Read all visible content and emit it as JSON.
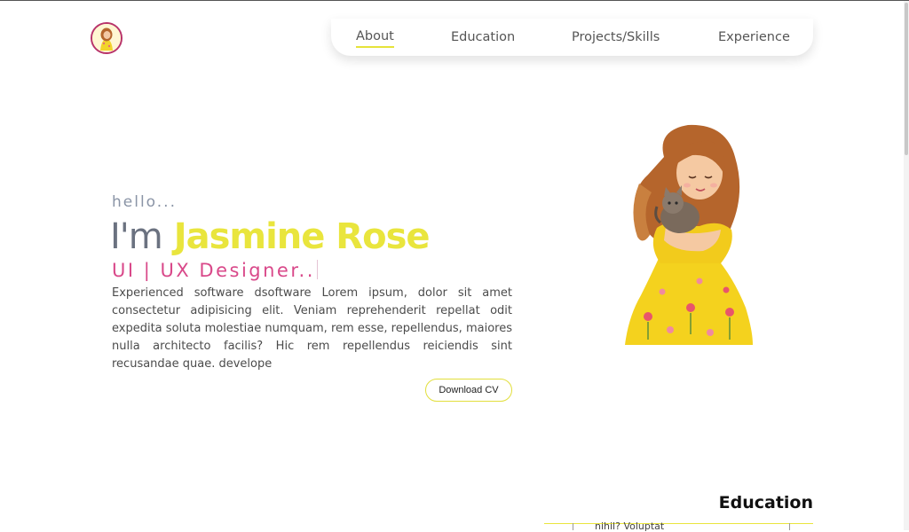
{
  "nav": {
    "items": [
      {
        "label": "About",
        "active": true
      },
      {
        "label": "Education",
        "active": false
      },
      {
        "label": "Projects/Skills",
        "active": false
      },
      {
        "label": "Experience",
        "active": false
      }
    ]
  },
  "hero": {
    "greeting": "hello...",
    "intro_prefix": "I'm",
    "name": "Jasmine Rose",
    "role": "UI | UX Designer..",
    "bio": "Experienced software dsoftware Lorem ipsum, dolor sit amet consectetur adipisicing elit. Veniam reprehenderit repellat odit expedita soluta molestiae numquam, rem esse, repellendus, maiores nulla architecto facilis? Hic rem repellendus reiciendis sint recusandae quae. develope",
    "cv_button": "Download CV"
  },
  "education": {
    "title": "Education",
    "snippet": "nihil? Voluptat"
  },
  "colors": {
    "accent_yellow": "#e9e53d",
    "accent_pink": "#d9498a",
    "muted_gray": "#6b7280"
  },
  "icons": {
    "logo": "avatar-logo-icon",
    "hero": "girl-with-cat-illustration"
  }
}
